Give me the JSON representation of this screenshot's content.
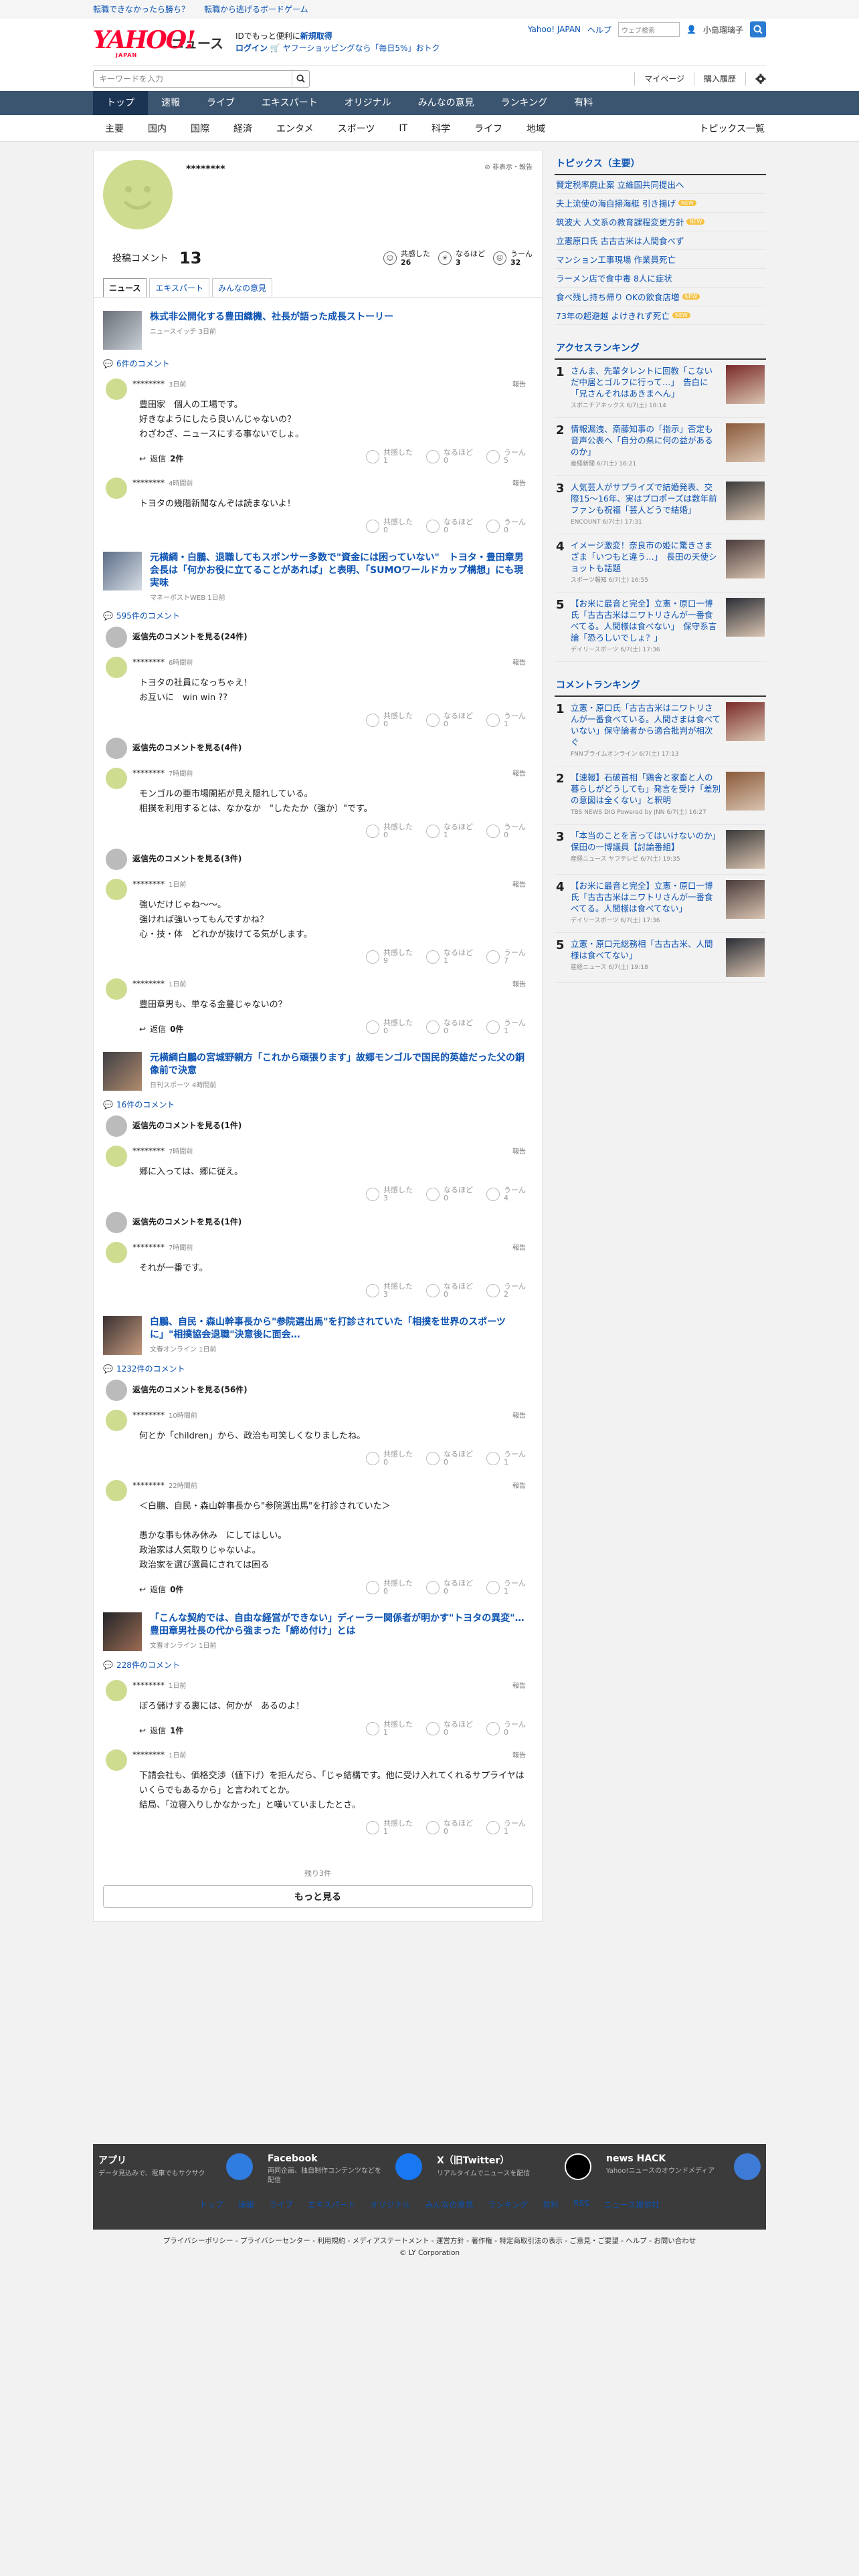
{
  "promo_bar": [
    "転職できなかったら勝ち？",
    "転職から逃げるボードゲーム"
  ],
  "header": {
    "logo": "YAHOO!",
    "logo_sub": "JAPAN",
    "service": "ニュース",
    "promo_line1_a": "IDでもっと便利に",
    "promo_line1_b": "新規取得",
    "promo_line2_a": "ログイン",
    "promo_line2_b": "ヤフーショッピングなら「毎日5%」おトク",
    "links": [
      "Yahoo! JAPAN",
      "ヘルプ"
    ],
    "web_search": "ウェブ検索",
    "user": "小島瑠璃子"
  },
  "searchbar": {
    "placeholder": "キーワードを入力",
    "mypage": "マイページ",
    "history": "購入履歴"
  },
  "nav": [
    "トップ",
    "速報",
    "ライブ",
    "エキスパート",
    "オリジナル",
    "みんなの意見",
    "ランキング",
    "有料"
  ],
  "subnav": [
    "主要",
    "国内",
    "国際",
    "経済",
    "エンタメ",
    "スポーツ",
    "IT",
    "科学",
    "ライフ",
    "地域"
  ],
  "subnav_right": "トピックス一覧",
  "user": {
    "name": "********",
    "flags": "非表示・報告",
    "post_label": "投稿コメント",
    "post_count": "13",
    "reacts": [
      {
        "label": "共感した",
        "value": "26"
      },
      {
        "label": "なるほど",
        "value": "3"
      },
      {
        "label": "うーん",
        "value": "32"
      }
    ]
  },
  "tabs": [
    "ニュース",
    "エキスパート",
    "みんなの意見"
  ],
  "articles": [
    {
      "title": "株式非公開化する豊田織機、社長が語った成長ストーリー",
      "src": "ニュースイッチ 3日前",
      "count": "6件のコメント",
      "items": [
        {
          "kind": "comment",
          "name": "********",
          "time": "3日前",
          "report": "報告",
          "body": "豊田家　個人の工場です。\n好きなようにしたら良いんじゃないの？\nわざわざ、ニュースにする事ないでしょ。",
          "rx": [
            "1",
            "0",
            "5"
          ],
          "reply": {
            "label": "返信",
            "count": "2件"
          }
        },
        {
          "kind": "comment",
          "name": "********",
          "time": "4時間前",
          "report": "報告",
          "body": "トヨタの幾階新聞なんぞは読まないよ！",
          "rx": [
            "0",
            "0",
            "0"
          ]
        }
      ]
    },
    {
      "title": "元横綱・白鵬、退職してもスポンサー多数で\"資金には困っていない\"　トヨタ・豊田章男会長は「何かお役に立てることがあれば」と表明、「SUMOワールドカップ構想」にも現実味",
      "src": "マネーポストWEB 1日前",
      "count": "595件のコメント",
      "items": [
        {
          "kind": "hidden",
          "text": "返信先のコメントを見る(24件)"
        },
        {
          "kind": "comment",
          "name": "********",
          "time": "6時間前",
          "report": "報告",
          "body": "トヨタの社員になっちゃえ！\nお互いに　win win ??",
          "rx": [
            "0",
            "0",
            "1"
          ]
        },
        {
          "kind": "hidden",
          "text": "返信先のコメントを見る(4件)"
        },
        {
          "kind": "comment",
          "name": "********",
          "time": "7時間前",
          "report": "報告",
          "body": "モンゴルの亜市場開拓が見え隠れしている。\n相撲を利用するとは、なかなか　\"したたか（強か）\"です。",
          "rx": [
            "0",
            "1",
            "0"
          ]
        },
        {
          "kind": "hidden",
          "text": "返信先のコメントを見る(3件)"
        },
        {
          "kind": "comment",
          "name": "********",
          "time": "1日前",
          "report": "報告",
          "body": "強いだけじゃね〜〜。\n強ければ強いってもんですかね？\n心・技・体　どれかが抜けてる気がします。",
          "rx": [
            "9",
            "1",
            "7"
          ]
        },
        {
          "kind": "comment",
          "name": "********",
          "time": "1日前",
          "report": "報告",
          "body": "豊田章男も、単なる金蔓じゃないの？",
          "rx": [
            "0",
            "0",
            "1"
          ],
          "reply": {
            "label": "返信",
            "count": "0件"
          }
        }
      ]
    },
    {
      "title": "元横綱白鵬の宮城野親方「これから頑張ります」故郷モンゴルで国民的英雄だった父の銅像前で決意",
      "src": "日刊スポーツ 4時間前",
      "count": "16件のコメント",
      "items": [
        {
          "kind": "hidden",
          "text": "返信先のコメントを見る(1件)"
        },
        {
          "kind": "comment",
          "name": "********",
          "time": "7時間前",
          "report": "報告",
          "body": "郷に入っては、郷に従え。",
          "rx": [
            "3",
            "0",
            "4"
          ]
        },
        {
          "kind": "hidden",
          "text": "返信先のコメントを見る(1件)"
        },
        {
          "kind": "comment",
          "name": "********",
          "time": "7時間前",
          "report": "報告",
          "body": "それが一番です。",
          "rx": [
            "3",
            "0",
            "2"
          ]
        }
      ]
    },
    {
      "title": "白鵬、自民・森山幹事長から\"参院選出馬\"を打診されていた「相撲を世界のスポーツに」\"相撲協会退職\"決意後に面会…",
      "src": "文春オンライン 1日前",
      "count": "1232件のコメント",
      "items": [
        {
          "kind": "hidden",
          "text": "返信先のコメントを見る(56件)"
        },
        {
          "kind": "comment",
          "name": "********",
          "time": "10時間前",
          "report": "報告",
          "body": "何とか「children」から、政治も可笑しくなりましたね。",
          "rx": [
            "0",
            "0",
            "1"
          ]
        },
        {
          "kind": "comment",
          "name": "********",
          "time": "22時間前",
          "report": "報告",
          "body": "＜白鵬、自民・森山幹事長から\"参院選出馬\"を打診されていた＞\n\n愚かな事も休み休み　にしてはしい。\n政治家は人気取りじゃないよ。\n政治家を選び選員にされては困る",
          "rx": [
            "0",
            "0",
            "1"
          ],
          "reply": {
            "label": "返信",
            "count": "0件"
          }
        }
      ]
    },
    {
      "title": "「こんな契約では、自由な経営ができない」ディーラー関係者が明かす\"トヨタの異変\"…豊田章男社長の代から強まった「締め付け」とは",
      "src": "文春オンライン 1日前",
      "count": "228件のコメント",
      "items": [
        {
          "kind": "comment",
          "name": "********",
          "time": "1日前",
          "report": "報告",
          "body": "ぼろ儲けする裏には、何かが　あるのよ！",
          "rx": [
            "1",
            "0",
            "0"
          ],
          "reply": {
            "label": "返信",
            "count": "1件"
          }
        },
        {
          "kind": "comment",
          "name": "********",
          "time": "1日前",
          "report": "報告",
          "body": "下請会社も、価格交渉（値下げ）を拒んだら、「じゃ結構です。他に受け入れてくれるサプライヤはいくらでもあるから」と言われてとか。\n結局、「泣寝入りしかなかった」と嘆いていましたとさ。",
          "rx": [
            "1",
            "0",
            "1"
          ]
        }
      ]
    }
  ],
  "remain": "残り3件",
  "more": "もっと見る",
  "side": {
    "topics_title": "トピックス（主要）",
    "topics": [
      {
        "t": "賢定税率廃止案 立維国共同提出へ",
        "new": false
      },
      {
        "t": "夫上流使の海自掃海艇 引き揚げ",
        "new": true
      },
      {
        "t": "筑波大 人文系の教育課程変更方針",
        "new": true
      },
      {
        "t": "立憲原口氏 古古古米は人間食べず",
        "new": false
      },
      {
        "t": "マンション工事現場 作業員死亡",
        "new": false
      },
      {
        "t": "ラーメン店で食中毒 8人に症状",
        "new": false
      },
      {
        "t": "食べ残し持ち帰り OKの飲食店増",
        "new": true
      },
      {
        "t": "73年の超避越 よけきれず死亡",
        "new": true
      }
    ],
    "new_label": "NEW",
    "access_title": "アクセスランキング",
    "access": [
      {
        "no": "1",
        "t": "さんま、先輩タレントに回教「こないだ中居とゴルフに行って…」　告白に「兄さんそれはあきまへん」",
        "s": "スポニチアネックス 6/7(土) 18:14"
      },
      {
        "no": "2",
        "t": "情報漏洩、斎藤知事の「指示」否定も音声公表へ「自分の県に何の益があるのか」",
        "s": "産経新聞 6/7(土) 16:21"
      },
      {
        "no": "3",
        "t": "人気芸人がサプライズで結婚発表、交際15〜16年、実はプロポーズは数年前　ファンも祝福「芸人どうで結婚」",
        "s": "ENCOUNT 6/7(土) 17:31"
      },
      {
        "no": "4",
        "t": "イメージ激変！奈良市の姫に驚きさまざま「いつもと違う…」　長田の天使ショットも話題",
        "s": "スポーツ報知 6/7(土) 16:55"
      },
      {
        "no": "5",
        "t": "【お米に最音と完全】立憲・原口一博氏「古古古米はニワトリさんが一番食べてる。人間様は食べない」　保守系言論「恐ろしいでしょ？」",
        "s": "デイリースポーツ 6/7(土) 17:36"
      }
    ],
    "comment_title": "コメントランキング",
    "comment": [
      {
        "no": "1",
        "t": "立憲・原口氏「古古古米はニワトリさんが一番食べている。人間さまは食べていない」保守論者から適合批判が相次ぐ",
        "s": "FNNプライムオンライン 6/7(土) 17:13"
      },
      {
        "no": "2",
        "t": "【速報】石破首相「鶏舎と家畜と人の暮らしがどうしても」発言を受け「差別の意図は全くない」と釈明",
        "s": "TBS NEWS DIG Powered by JNN 6/7(土) 16:27"
      },
      {
        "no": "3",
        "t": "「本当のことを言ってはいけないのか」保田の一博議員【討論番組】",
        "s": "産経ニュース ヤフテレビ 6/7(土) 19:35"
      },
      {
        "no": "4",
        "t": "【お米に最音と完全】立憲・原口一博氏「古古古米はニワトリさんが一番食べてる。人間様は食べてない」",
        "s": "デイリースポーツ 6/7(土) 17:36"
      },
      {
        "no": "5",
        "t": "立憲・原口元総務相「古古古米、人間様は食べてない」",
        "s": "産経ニュース 6/7(土) 19:18"
      }
    ]
  },
  "footer": {
    "apps": [
      {
        "h": "アプリ",
        "d": "データ見込みで、電車でもサクサク"
      },
      {
        "h": "Facebook",
        "d": "両同企画、独自制作コンテンツなどを配信"
      },
      {
        "h": "X（旧Twitter）",
        "d": "リアルタイムでニュースを配信"
      },
      {
        "h": "news HACK",
        "d": "Yahoo!ニュースのオウンドメディア"
      }
    ],
    "nav": [
      "トップ",
      "速報",
      "ライブ",
      "エキスパート",
      "オリジナル",
      "みんなの意見",
      "ランキング",
      "有料",
      "RSS",
      "ニュース提供社"
    ],
    "legal": "プライバシーポリシー - プライバシーセンター - 利用規約 - メディアステートメント - 運営方針 - 著作権 - 特定商取引法の表示 - ご意見・ご要望 - ヘルプ - お問い合わせ",
    "copy": "© LY Corporation"
  },
  "colors": {
    "link": "#0b52b2",
    "nav": "#3b5570",
    "nav_active": "#1b3454",
    "avatar": "#cddc8f",
    "brand": "#ff0033"
  }
}
